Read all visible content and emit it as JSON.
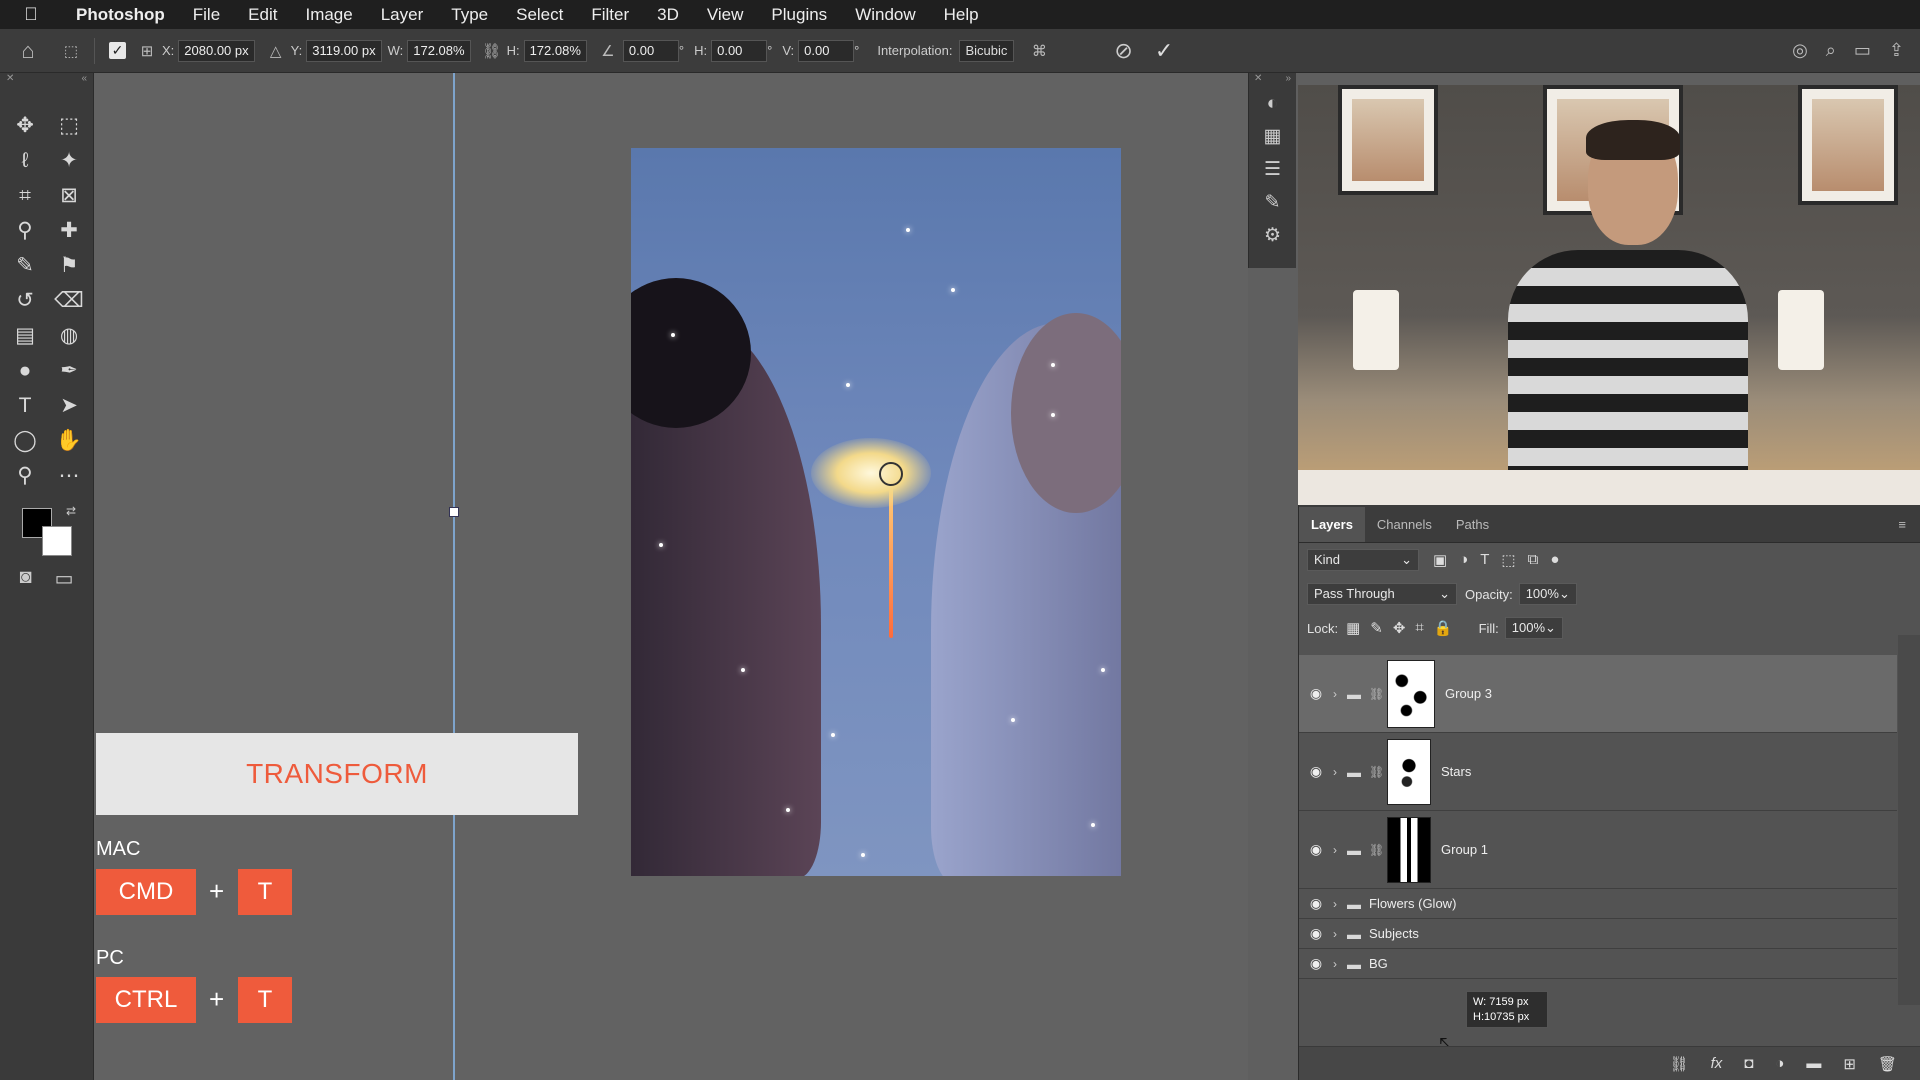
{
  "menubar": {
    "apple": "",
    "app": "Photoshop",
    "items": [
      "File",
      "Edit",
      "Image",
      "Layer",
      "Type",
      "Select",
      "Filter",
      "3D",
      "View",
      "Plugins",
      "Window",
      "Help"
    ]
  },
  "options": {
    "x_label": "X:",
    "x_value": "2080.00 px",
    "y_label": "Y:",
    "y_value": "3119.00 px",
    "w_label": "W:",
    "w_value": "172.08%",
    "h_label": "H:",
    "h_value": "172.08%",
    "angle_value": "0.00",
    "angle_unit": "°",
    "hskew_label": "H:",
    "hskew_value": "0.00",
    "hskew_unit": "°",
    "vskew_label": "V:",
    "vskew_value": "0.00",
    "vskew_unit": "°",
    "interp_label": "Interpolation:",
    "interp_value": "Bicubic"
  },
  "overlay": {
    "title": "TRANSFORM",
    "mac_label": "MAC",
    "mac_key1": "CMD",
    "mac_plus": "+",
    "mac_key2": "T",
    "pc_label": "PC",
    "pc_key1": "CTRL",
    "pc_plus": "+",
    "pc_key2": "T"
  },
  "layers_panel": {
    "tabs": [
      "Layers",
      "Channels",
      "Paths"
    ],
    "filter_kind": "Kind",
    "blend_mode": "Pass Through",
    "opacity_label": "Opacity:",
    "opacity_value": "100%",
    "lock_label": "Lock:",
    "fill_label": "Fill:",
    "fill_value": "100%",
    "layers": [
      {
        "name": "Group 3",
        "selected": true
      },
      {
        "name": "Stars",
        "selected": false
      },
      {
        "name": "Group 1",
        "selected": false
      },
      {
        "name": "Flowers (Glow)",
        "selected": false
      },
      {
        "name": "Subjects",
        "selected": false
      },
      {
        "name": "BG",
        "selected": false
      }
    ]
  },
  "tooltip": {
    "w": "W:  7159 px",
    "h": "H:10735 px"
  },
  "colors": {
    "accent": "#ef5b3c",
    "panel": "#535353",
    "canvas_bg": "#626262"
  }
}
